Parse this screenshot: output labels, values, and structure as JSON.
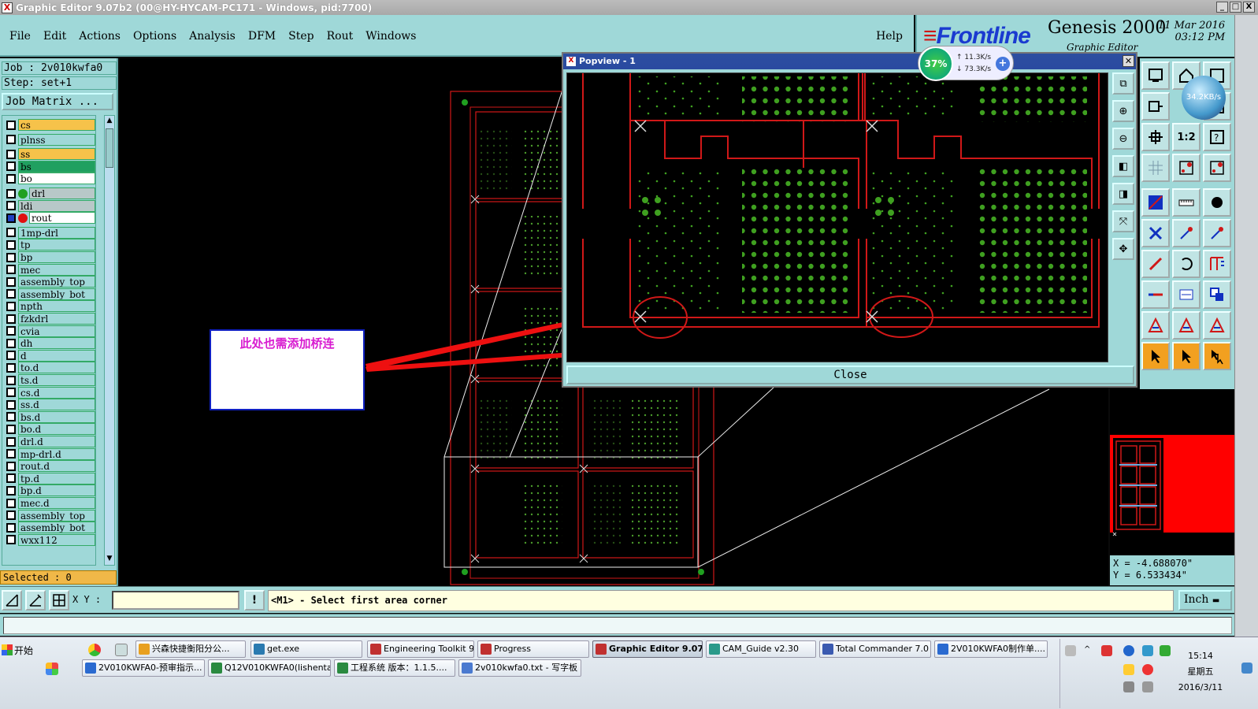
{
  "window": {
    "title": "Graphic Editor 9.07b2 (00@HY-HYCAM-PC171 - Windows, pid:7700)",
    "buttons": [
      "_",
      "□",
      "X"
    ]
  },
  "menu": {
    "items": [
      "File",
      "Edit",
      "Actions",
      "Options",
      "Analysis",
      "DFM",
      "Step",
      "Rout",
      "Windows"
    ],
    "help": "Help"
  },
  "brand": {
    "logo": "Frontline",
    "product": "Genesis 2000",
    "subtitle": "Graphic Editor",
    "date": "11 Mar 2016",
    "time": "03:12 PM"
  },
  "job": {
    "job_line": "Job : 2v010kwfa0",
    "step_line": "Step: set+1",
    "matrix_button": "Job Matrix ..."
  },
  "layers": [
    {
      "name": "cs",
      "bg": "#f6c24a",
      "dot": ""
    },
    {
      "name": "plnss",
      "bg": "#9fd8d8",
      "dot": ""
    },
    {
      "name": "ss",
      "bg": "#f6c24a",
      "dot": ""
    },
    {
      "name": "bs",
      "bg": "#20a060",
      "dot": ""
    },
    {
      "name": "bo",
      "bg": "#ffffff",
      "dot": ""
    },
    {
      "name": "drl",
      "bg": "#b8c8c8",
      "dot": "#20a020"
    },
    {
      "name": "ldi",
      "bg": "#b8c8c8",
      "dot": ""
    },
    {
      "name": "rout",
      "bg": "#ffffff",
      "dot": "#e01010"
    },
    {
      "name": "1mp-drl",
      "bg": "#9fd8d8",
      "dot": ""
    },
    {
      "name": "tp",
      "bg": "#9fd8d8",
      "dot": ""
    },
    {
      "name": "bp",
      "bg": "#9fd8d8",
      "dot": ""
    },
    {
      "name": "mec",
      "bg": "#9fd8d8",
      "dot": ""
    },
    {
      "name": "assembly_top",
      "bg": "#9fd8d8",
      "dot": ""
    },
    {
      "name": "assembly_bot",
      "bg": "#9fd8d8",
      "dot": ""
    },
    {
      "name": "npth",
      "bg": "#9fd8d8",
      "dot": ""
    },
    {
      "name": "fzkdrl",
      "bg": "#9fd8d8",
      "dot": ""
    },
    {
      "name": "cvia",
      "bg": "#9fd8d8",
      "dot": ""
    },
    {
      "name": "dh",
      "bg": "#9fd8d8",
      "dot": ""
    },
    {
      "name": "d",
      "bg": "#9fd8d8",
      "dot": ""
    },
    {
      "name": "to.d",
      "bg": "#9fd8d8",
      "dot": ""
    },
    {
      "name": "ts.d",
      "bg": "#9fd8d8",
      "dot": ""
    },
    {
      "name": "cs.d",
      "bg": "#9fd8d8",
      "dot": ""
    },
    {
      "name": "ss.d",
      "bg": "#9fd8d8",
      "dot": ""
    },
    {
      "name": "bs.d",
      "bg": "#9fd8d8",
      "dot": ""
    },
    {
      "name": "bo.d",
      "bg": "#9fd8d8",
      "dot": ""
    },
    {
      "name": "drl.d",
      "bg": "#9fd8d8",
      "dot": ""
    },
    {
      "name": "mp-drl.d",
      "bg": "#9fd8d8",
      "dot": ""
    },
    {
      "name": "rout.d",
      "bg": "#9fd8d8",
      "dot": ""
    },
    {
      "name": "tp.d",
      "bg": "#9fd8d8",
      "dot": ""
    },
    {
      "name": "bp.d",
      "bg": "#9fd8d8",
      "dot": ""
    },
    {
      "name": "mec.d",
      "bg": "#9fd8d8",
      "dot": ""
    },
    {
      "name": "assembly_top",
      "bg": "#9fd8d8",
      "dot": ""
    },
    {
      "name": "assembly_bot",
      "bg": "#9fd8d8",
      "dot": ""
    },
    {
      "name": "wxx112",
      "bg": "#9fd8d8",
      "dot": ""
    }
  ],
  "selected": "Selected : 0",
  "callout": {
    "text": "此处也需添加桥连"
  },
  "popview": {
    "title": "Popview - 1",
    "close_button": "Close"
  },
  "netmeter": {
    "percent": "37%",
    "up": "11.3K/s",
    "down": "73.3K/s",
    "bubble": "34.2KB/s"
  },
  "coords": {
    "x": "X = -4.688070\"",
    "y": "Y = 6.533434\""
  },
  "command": {
    "xy_label": "X Y :",
    "xy_value": "",
    "prompt": "<M1> - Select first area corner",
    "units": "Inch"
  },
  "taskbar": {
    "start": "开始",
    "row1": [
      {
        "label": "兴森快捷衡阳分公...",
        "color": "#e8a020"
      },
      {
        "label": "get.exe",
        "color": "#2a7ab0"
      },
      {
        "label": "Engineering Toolkit 9....",
        "color": "#c03030"
      },
      {
        "label": "Progress",
        "color": "#c03030"
      },
      {
        "label": "Graphic Editor 9.07...",
        "color": "#c03030"
      },
      {
        "label": "CAM_Guide v2.30",
        "color": "#2a9a8a"
      },
      {
        "label": "Total Commander 7.0 ...",
        "color": "#3a5ab0"
      },
      {
        "label": "2V010KWFA0制作单....",
        "color": "#2a6ad0"
      }
    ],
    "row2": [
      {
        "label": "2V010KWFA0-预审指示...",
        "color": "#2a6ad0"
      },
      {
        "label": "Q12V010KWFA0(lishenta...",
        "color": "#2a8a40"
      },
      {
        "label": "工程系统   版本：1.1.5....",
        "color": "#2a8a40"
      },
      {
        "label": "2v010kwfa0.txt - 写字板",
        "color": "#4a7ad0"
      }
    ],
    "clock_time": "15:14",
    "clock_day": "星期五",
    "clock_date": "2016/3/11"
  },
  "toolbar_icons": [
    "popview-icon",
    "zoom-icon",
    "pan-icon",
    "one-to-one-icon",
    "help-icon"
  ]
}
